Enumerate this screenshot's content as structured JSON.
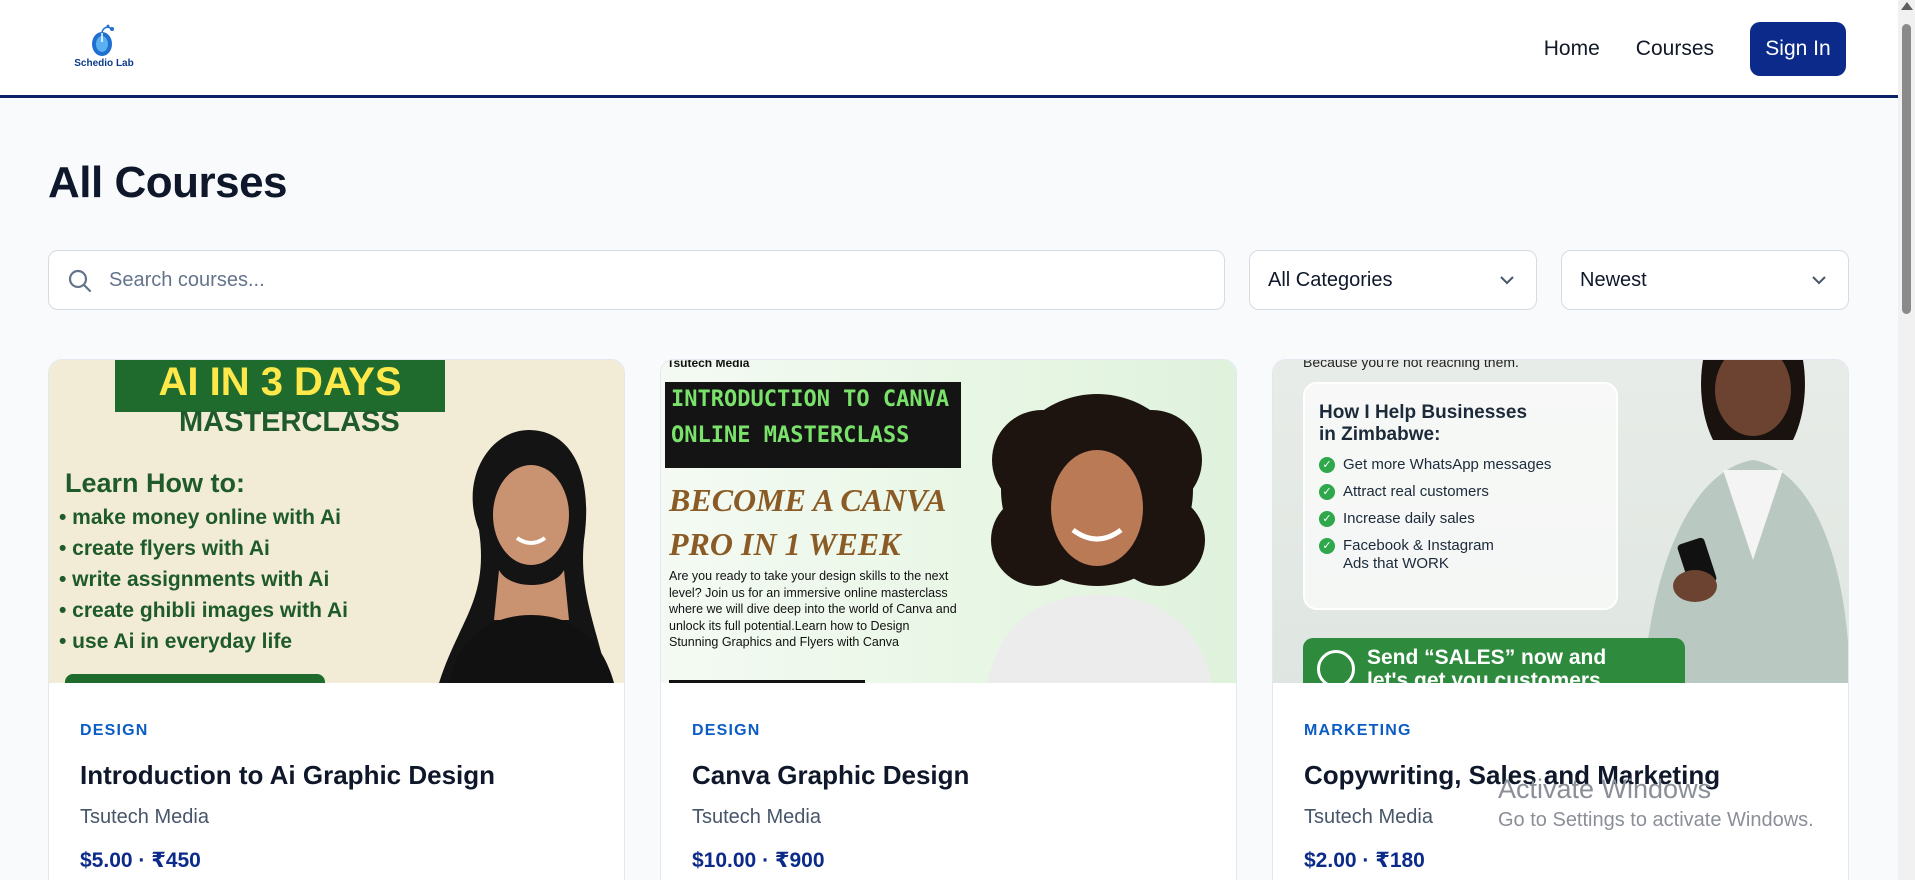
{
  "header": {
    "logo_text": "Schedio Lab",
    "nav": [
      {
        "label": "Home"
      },
      {
        "label": "Courses"
      }
    ],
    "signin_label": "Sign In"
  },
  "page": {
    "title": "All Courses"
  },
  "filters": {
    "search_placeholder": "Search courses...",
    "search_value": "",
    "category_selected": "All Categories",
    "sort_selected": "Newest"
  },
  "courses": [
    {
      "category": "DESIGN",
      "title": "Introduction to Ai Graphic Design",
      "author": "Tsutech Media",
      "price": "$5.00 · ₹450",
      "thumb": {
        "banner": "AI IN 3 DAYS",
        "sub": "MASTERCLASS",
        "heading": "Learn How to:",
        "items": [
          "• make money online with Ai",
          "• create flyers with Ai",
          "• write assignments with Ai",
          "• create ghibli images with Ai",
          "• use Ai in everyday life"
        ]
      }
    },
    {
      "category": "DESIGN",
      "title": "Canva Graphic Design",
      "author": "Tsutech Media",
      "price": "$10.00 · ₹900",
      "thumb": {
        "topline": "Tsutech Media",
        "box_line1": "INTRODUCTION TO CANVA",
        "box_line2": "ONLINE MASTERCLASS",
        "big_line1": "BECOME A CANVA",
        "big_line2": "PRO IN 1 WEEK",
        "paragraph": "Are you ready to take your design skills to the next level? Join us for an immersive online masterclass where we will dive deep into the world of Canva and unlock its full potential.Learn how to Design Stunning Graphics and Flyers with Canva"
      }
    },
    {
      "category": "MARKETING",
      "title": "Copywriting, Sales and Marketing",
      "author": "Tsutech Media",
      "price": "$2.00 · ₹180",
      "thumb": {
        "top": "Because you're not reaching them.",
        "heading_line1": "How I Help Businesses",
        "heading_line2": "in Zimbabwe:",
        "items": [
          "Get more WhatsApp messages",
          "Attract real customers",
          "Increase daily sales",
          "Facebook & Instagram",
          "Ads that WORK"
        ],
        "cta_line1": "Send “SALES” now and",
        "cta_line2": "let's get you customers"
      }
    }
  ],
  "watermark": {
    "line1": "Activate Windows",
    "line2": "Go to Settings to activate Windows."
  },
  "colors": {
    "brand": "#0b2a8a",
    "category": "#0b5cc4",
    "header_border": "#0b1f6b"
  }
}
